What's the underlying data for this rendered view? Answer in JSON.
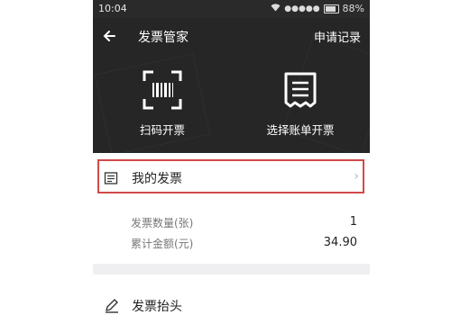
{
  "status_bar": {
    "time": "10:04",
    "battery_pct": "88%",
    "signal_dots": "●●●●●"
  },
  "header": {
    "title": "发票管家",
    "apply_record": "申请记录",
    "actions": [
      {
        "label": "扫码开票",
        "icon": "barcode-scan-icon"
      },
      {
        "label": "选择账单开票",
        "icon": "receipt-icon"
      }
    ]
  },
  "my_invoice": {
    "label": "我的发票",
    "icon": "invoice-list-icon",
    "highlight_color": "#d14a4a"
  },
  "stats": [
    {
      "label": "发票数量(张)",
      "value": "1"
    },
    {
      "label": "累计金额(元)",
      "value": "34.90"
    }
  ],
  "invoice_header": {
    "label": "发票抬头",
    "icon": "pen-icon"
  },
  "colors": {
    "header_bg": "#262626",
    "page_bg": "#efeff1",
    "highlight": "#d14a4a"
  }
}
